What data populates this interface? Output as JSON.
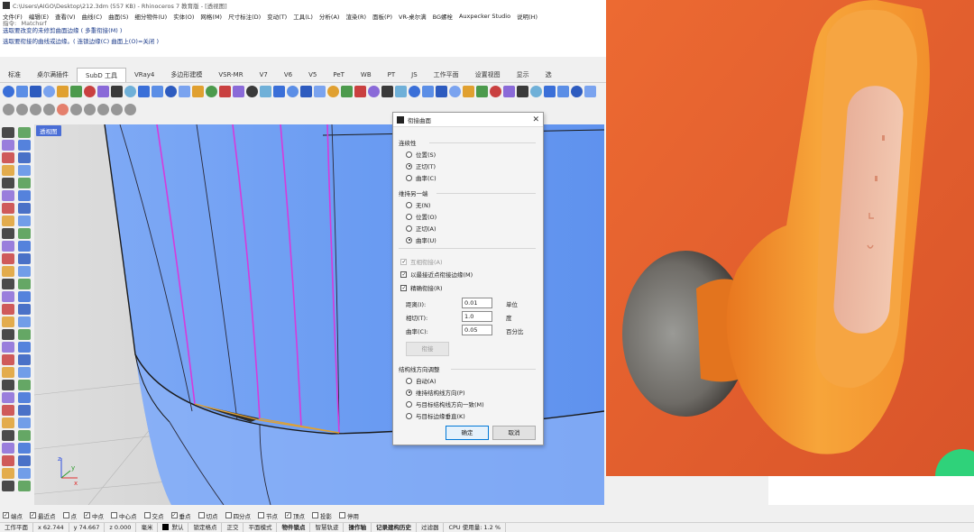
{
  "window": {
    "title": "C:\\Users\\AIGO\\Desktop\\212.3dm (557 KB) - Rhinoceros 7 教育版 - [透视图]"
  },
  "menu": [
    "文件(F)",
    "编辑(E)",
    "查看(V)",
    "曲线(C)",
    "曲面(S)",
    "细分物件(U)",
    "实体(O)",
    "网格(M)",
    "尺寸标注(D)",
    "变动(T)",
    "工具(L)",
    "分析(A)",
    "渲染(R)",
    "面板(P)",
    "VR-桌尔满",
    "BG螺栓",
    "Auxpecker Studio",
    "说明(H)"
  ],
  "command_history": [
    "指令: _Matchsrf",
    "选取要改变的未修剪曲面边缘 ( 多重衔接(M) )",
    "选取要衔接的曲线或边缘。( 连锁边缘(C)  曲面上(O)=关闭 )"
  ],
  "tabs": [
    "标准",
    "桌尔满插件",
    "SubD 工具",
    "VRay4",
    "多边形建模",
    "VSR-MR",
    "V7",
    "V6",
    "V5",
    "PeT",
    "WB",
    "PT",
    "JS",
    "工作平面",
    "设置视图",
    "显示",
    "选"
  ],
  "active_tab": "SubD 工具",
  "viewport": {
    "label": "透视图",
    "axis": {
      "x": "x",
      "y": "y",
      "z": "z"
    }
  },
  "dialog": {
    "title": "衔接曲面",
    "continuity": {
      "label": "连续性",
      "options": [
        "位置(S)",
        "正切(T)",
        "曲率(C)"
      ],
      "selected": "正切(T)"
    },
    "preserve": {
      "label": "维持另一端",
      "options": [
        "无(N)",
        "位置(O)",
        "正切(A)",
        "曲率(U)"
      ],
      "selected": "曲率(U)"
    },
    "checks": [
      {
        "label": "互相衔接(A)",
        "checked": true,
        "disabled": true
      },
      {
        "label": "以最接近点衔接边缘(M)",
        "checked": true,
        "disabled": false
      },
      {
        "label": "精确衔接(R)",
        "checked": true,
        "disabled": false
      }
    ],
    "tolerances": [
      {
        "label": "距离(I):",
        "value": "0.01",
        "unit": "单位"
      },
      {
        "label": "相切(T):",
        "value": "1.0",
        "unit": "度"
      },
      {
        "label": "曲率(C):",
        "value": "0.05",
        "unit": "百分比"
      }
    ],
    "match_button": "衔接",
    "isocurve": {
      "label": "结构线方向调整",
      "options": [
        "自动(A)",
        "维持结构线方向(P)",
        "与目标结构线方向一致(M)",
        "与目标边缘垂直(K)"
      ],
      "selected": "维持结构线方向(P)"
    },
    "ok": "确定",
    "cancel": "取消"
  },
  "osnaps": [
    {
      "label": "端点",
      "checked": true
    },
    {
      "label": "最近点",
      "checked": true
    },
    {
      "label": "点",
      "checked": false
    },
    {
      "label": "中点",
      "checked": true
    },
    {
      "label": "中心点",
      "checked": false
    },
    {
      "label": "交点",
      "checked": false
    },
    {
      "label": "垂点",
      "checked": true
    },
    {
      "label": "切点",
      "checked": false
    },
    {
      "label": "四分点",
      "checked": false
    },
    {
      "label": "节点",
      "checked": false
    },
    {
      "label": "顶点",
      "checked": true
    },
    {
      "label": "投影",
      "checked": false
    },
    {
      "label": "停用",
      "checked": false
    }
  ],
  "statusbar": {
    "cplane": "工作平面",
    "x": "x 62.744",
    "y": "y 74.667",
    "z": "z 0.000",
    "units": "毫米",
    "layer": "默认",
    "toggles": [
      "锁定格点",
      "正交",
      "平面模式",
      "物件锁点",
      "智慧轨迹",
      "操作轴",
      "记录建构历史",
      "过滤器"
    ],
    "cpu": "CPU 使用量: 1.2 %"
  },
  "colors": {
    "viewport_surface": "#6ea0f5",
    "isocurve_magenta": "#d63adb",
    "photo_bg": "#e35f2d",
    "earbud_orange": "#f39a2a",
    "accent_blue": "#4a6ed6"
  }
}
